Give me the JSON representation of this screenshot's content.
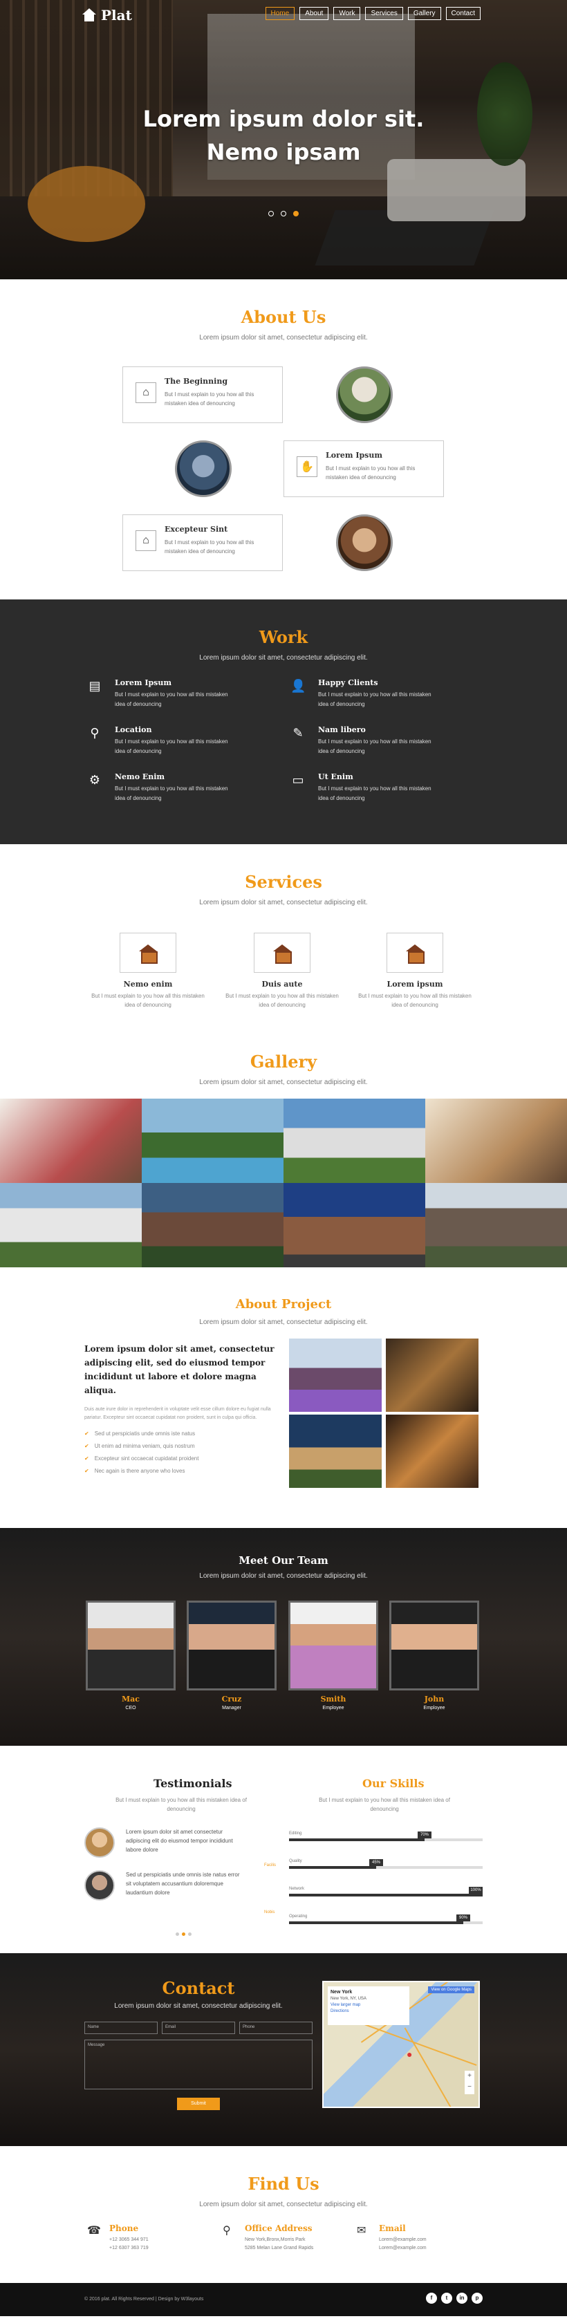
{
  "brand": {
    "name": "Plat",
    "accent": "#f09a1a",
    "dark": "#2c2c2c"
  },
  "nav": [
    "Home",
    "About",
    "Work",
    "Services",
    "Gallery",
    "Contact"
  ],
  "hero": {
    "line1": "Lorem ipsum dolor sit.",
    "line2": "Nemo ipsam",
    "slides": 3,
    "active_slide": 3
  },
  "about": {
    "title": "About Us",
    "subtitle": "Lorem ipsum dolor sit amet, consectetur adipiscing elit.",
    "cards": [
      {
        "title": "The Beginning",
        "text": "But I must explain to you how all this mistaken idea of denouncing",
        "icon": "house-icon"
      },
      {
        "title": "Lorem Ipsum",
        "text": "But I must explain to you how all this mistaken idea of denouncing",
        "icon": "handshake-icon"
      },
      {
        "title": "Excepteur Sint",
        "text": "But I must explain to you how all this mistaken idea of denouncing",
        "icon": "house-icon"
      }
    ]
  },
  "work": {
    "title": "Work",
    "subtitle": "Lorem ipsum dolor sit amet, consectetur adipiscing elit.",
    "items": [
      {
        "title": "Lorem Ipsum",
        "text": "But I must explain to you how all this mistaken idea of denouncing",
        "icon": "certificate-icon"
      },
      {
        "title": "Happy Clients",
        "text": "But I must explain to you how all this mistaken idea of denouncing",
        "icon": "user-icon"
      },
      {
        "title": "Location",
        "text": "But I must explain to you how all this mistaken idea of denouncing",
        "icon": "location-icon"
      },
      {
        "title": "Nam libero",
        "text": "But I must explain to you how all this mistaken idea of denouncing",
        "icon": "edit-icon"
      },
      {
        "title": "Nemo Enim",
        "text": "But I must explain to you how all this mistaken idea of denouncing",
        "icon": "gear-icon"
      },
      {
        "title": "Ut Enim",
        "text": "But I must explain to you how all this mistaken idea of denouncing",
        "icon": "card-icon"
      }
    ]
  },
  "services": {
    "title": "Services",
    "subtitle": "Lorem ipsum dolor sit amet, consectetur adipiscing elit.",
    "items": [
      {
        "title": "Nemo enim",
        "text": "But I must explain to you how all this mistaken idea of denouncing"
      },
      {
        "title": "Duis aute",
        "text": "But I must explain to you how all this mistaken idea of denouncing"
      },
      {
        "title": "Lorem ipsum",
        "text": "But I must explain to you how all this mistaken idea of denouncing"
      }
    ]
  },
  "gallery": {
    "title": "Gallery",
    "subtitle": "Lorem ipsum dolor sit amet, consectetur adipiscing elit."
  },
  "project": {
    "title": "About Project",
    "subtitle": "Lorem ipsum dolor sit amet, consectetur adipiscing elit.",
    "heading": "Lorem ipsum dolor sit amet, consectetur adipiscing elit, sed do eiusmod tempor incididunt ut labore et dolore magna aliqua.",
    "paragraph": "Duis aute irure dolor in reprehenderit in voluptate velit esse cillum dolore eu fugiat nulla pariatur. Excepteur sint occaecat cupidatat non proident, sunt in culpa qui officia.",
    "list": [
      "Sed ut perspiciatis unde omnis iste natus",
      "Ut enim ad minima veniam, quis nostrum",
      "Excepteur sint occaecat cupidatat proident",
      "Nec again is there anyone who loves"
    ]
  },
  "team": {
    "title": "Meet Our Team",
    "subtitle": "Lorem ipsum dolor sit amet, consectetur adipiscing elit.",
    "members": [
      {
        "name": "Mac",
        "role": "CEO"
      },
      {
        "name": "Cruz",
        "role": "Manager"
      },
      {
        "name": "Smith",
        "role": "Employee"
      },
      {
        "name": "John",
        "role": "Employee"
      }
    ]
  },
  "testimonials": {
    "title": "Testimonials",
    "text": "But I must explain to you how all this mistaken idea of denouncing",
    "quotes": [
      "Lorem ipsum dolor sit amet consectetur adipiscing elit do eiusmod tempor incididunt labore dolore",
      "Sed ut perspiciatis unde omnis iste natus error sit voluptatem accusantium doloremque laudantium dolore"
    ]
  },
  "skills": {
    "title": "Our Skills",
    "text": "But I must explain to you how all this mistaken idea of denouncing",
    "side_labels": [
      "Facilis",
      "Nobis"
    ],
    "items": [
      {
        "name": "Editing",
        "value": 70,
        "label": "70%",
        "scale_min": "0%",
        "scale_max": "100%"
      },
      {
        "name": "Quality",
        "value": 45,
        "label": "45%",
        "scale_min": "0%",
        "scale_max": "100%"
      },
      {
        "name": "Network",
        "value": 100,
        "label": "100%",
        "scale_min": "0%",
        "scale_max": "100%"
      },
      {
        "name": "Operating",
        "value": 90,
        "label": "90%",
        "scale_min": "0%",
        "scale_max": "100%"
      }
    ]
  },
  "contact": {
    "title": "Contact",
    "subtitle": "Lorem ipsum dolor sit amet, consectetur adipiscing elit.",
    "fields": {
      "name": "Name",
      "email": "Email",
      "phone": "Phone",
      "message": "Message"
    },
    "submit": "Submit",
    "map": {
      "title": "New York",
      "sub": "New York, NY, USA",
      "link": "View larger map",
      "directions": "Directions",
      "button": "View on Google Maps"
    }
  },
  "find": {
    "title": "Find Us",
    "subtitle": "Lorem ipsum dolor sit amet, consectetur adipiscing elit.",
    "items": [
      {
        "title": "Phone",
        "lines": [
          "+12 3065 344 971",
          "+12 6307 363 719"
        ],
        "icon": "phone-icon"
      },
      {
        "title": "Office Address",
        "lines": [
          "New York,Bronx,Morris Park",
          "5285 Melan Lane Grand Rapids"
        ],
        "icon": "location-icon"
      },
      {
        "title": "Email",
        "lines": [
          "Lorem@example.com",
          "Lorem@example.com"
        ],
        "icon": "mail-icon"
      }
    ]
  },
  "footer": {
    "copyright": "© 2016 plat. All Rights Reserved | Design by W3layouts",
    "social": [
      "f",
      "t",
      "in",
      "p"
    ]
  }
}
